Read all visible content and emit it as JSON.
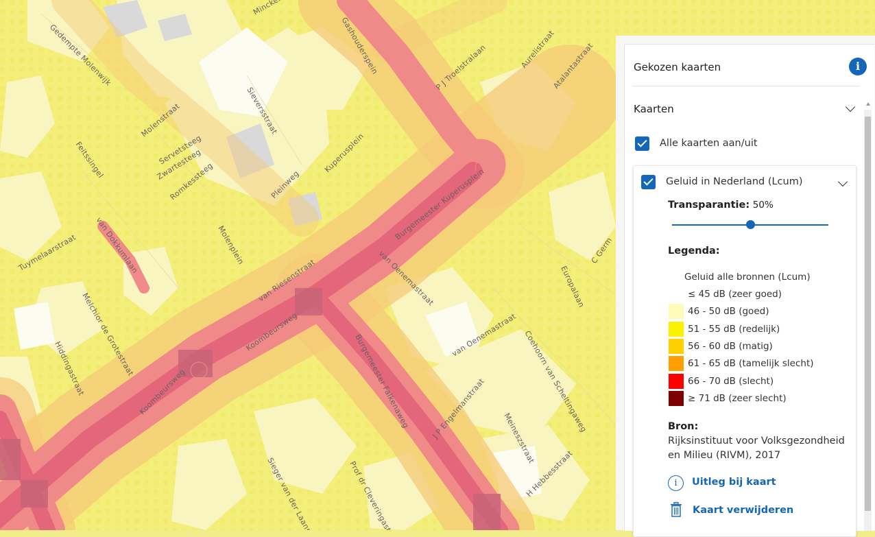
{
  "map": {
    "streets": [
      {
        "name": "Gedempte Molenwijk"
      },
      {
        "name": "Minckel"
      },
      {
        "name": "Gasthuisplein"
      },
      {
        "name": "Gashouderspein"
      },
      {
        "name": "P J Troelstralaan"
      },
      {
        "name": "Aurelistraat"
      },
      {
        "name": "Atalantastraat"
      },
      {
        "name": "Molenstraat"
      },
      {
        "name": "Sieversstraat"
      },
      {
        "name": "Feitssingel"
      },
      {
        "name": "Servetsteeg"
      },
      {
        "name": "Zwartesteeg"
      },
      {
        "name": "Romkessteeg"
      },
      {
        "name": "Pleinweg"
      },
      {
        "name": "Kuperusplein"
      },
      {
        "name": "Burgemeester Kuperusplein"
      },
      {
        "name": "van Dokkumlaan"
      },
      {
        "name": "Tuymelaarstraat"
      },
      {
        "name": "Molenplein"
      },
      {
        "name": "van Riesenstraat"
      },
      {
        "name": "van Oenemastraat"
      },
      {
        "name": "Europalaan"
      },
      {
        "name": "Melchior de Grotestraat"
      },
      {
        "name": "Koombeursweg"
      },
      {
        "name": "Hiddingastraat"
      },
      {
        "name": "Burgemeester Falkenaweg"
      },
      {
        "name": "Coehoorn van Scheltingaweg"
      },
      {
        "name": "J P Engelmanstraat"
      },
      {
        "name": "Meineszstraat"
      },
      {
        "name": "H Hebbesstraat"
      },
      {
        "name": "Sieger van der Laanstraat"
      },
      {
        "name": "Prof dr Cleveringastraat"
      },
      {
        "name": "C Germ"
      }
    ]
  },
  "panel": {
    "title": "Gekozen kaarten",
    "info_icon": "info-icon",
    "section_title": "Kaarten",
    "toggle_all_label": "Alle kaarten aan/uit",
    "layer": {
      "name": "Geluid in Nederland (Lcum)",
      "transparency_label": "Transparantie:",
      "transparency_value": "50%",
      "transparency_fraction": 0.5,
      "legend_title": "Legenda:",
      "legend_subtitle": "Geluid alle bronnen (Lcum)",
      "legend": [
        {
          "label": "≤ 45 dB (zeer goed)",
          "color": "#ffffff"
        },
        {
          "label": "46 - 50 dB (goed)",
          "color": "#fdfcb9"
        },
        {
          "label": "51 - 55 dB (redelijk)",
          "color": "#fbf200"
        },
        {
          "label": "56 - 60 dB (matig)",
          "color": "#ffcf00"
        },
        {
          "label": "61 - 65 dB (tamelijk slecht)",
          "color": "#ff9f00"
        },
        {
          "label": "66 - 70 dB (slecht)",
          "color": "#ff0000"
        },
        {
          "label": "≥ 71 dB (zeer slecht)",
          "color": "#7f0000"
        }
      ],
      "source_title": "Bron:",
      "source_text_1": "Rijksinstituut voor Volksgezondheid",
      "source_text_2": "en Milieu (RIVM), 2017",
      "explain_link": "Uitleg bij kaart",
      "remove_link": "Kaart verwijderen"
    }
  }
}
